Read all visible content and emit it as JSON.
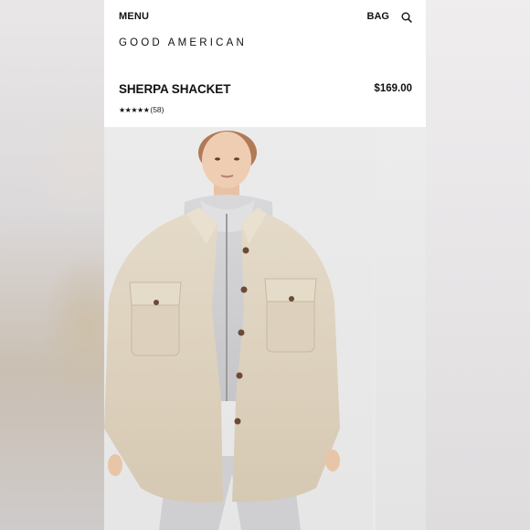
{
  "header": {
    "menu_label": "MENU",
    "bag_label": "BAG",
    "search_icon": "search-icon",
    "brand": "GOOD AMERICAN"
  },
  "product": {
    "title": "SHERPA SHACKET",
    "price": "$169.00",
    "rating_stars": "★★★★★",
    "rating": 5,
    "review_count": "(58)"
  },
  "gallery": {
    "main_image": "model-wearing-cream-sherpa-shacket-photo",
    "next_image": "next-product-photo-peek"
  },
  "colors": {
    "background": "#ffffff",
    "text": "#111111",
    "jacket": "#ddd2bf",
    "photo_backdrop": "#e9e9e9"
  }
}
